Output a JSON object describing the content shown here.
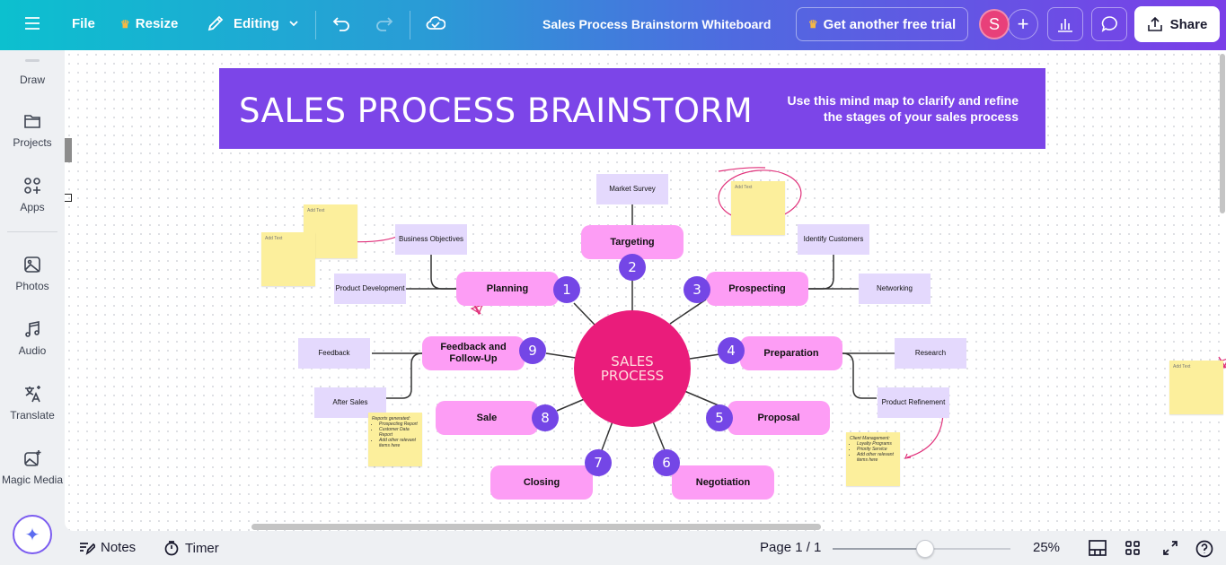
{
  "topbar": {
    "file_label": "File",
    "resize_label": "Resize",
    "editing_label": "Editing",
    "doc_title": "Sales Process Brainstorm Whiteboard",
    "trial_label": "Get another free trial",
    "avatar_initial": "S",
    "add_label": "+",
    "share_label": "Share"
  },
  "sidebar": {
    "items": [
      {
        "label": "Draw",
        "icon": "draw-icon"
      },
      {
        "label": "Projects",
        "icon": "folder-icon"
      },
      {
        "label": "Apps",
        "icon": "apps-icon"
      },
      {
        "label": "Photos",
        "icon": "photo-icon"
      },
      {
        "label": "Audio",
        "icon": "music-icon"
      },
      {
        "label": "Translate",
        "icon": "translate-icon"
      },
      {
        "label": "Magic Media",
        "icon": "magic-media-icon"
      }
    ],
    "magic_button": "✦"
  },
  "board": {
    "title": "SALES PROCESS BRAINSTORM",
    "subtitle_line1": "Use this mind map to clarify and refine",
    "subtitle_line2": "the stages of your sales process",
    "center_line1": "SALES",
    "center_line2": "PROCESS",
    "stages": [
      {
        "num": "1",
        "label": "Planning"
      },
      {
        "num": "2",
        "label": "Targeting"
      },
      {
        "num": "3",
        "label": "Prospecting"
      },
      {
        "num": "4",
        "label": "Preparation"
      },
      {
        "num": "5",
        "label": "Proposal"
      },
      {
        "num": "6",
        "label": "Negotiation"
      },
      {
        "num": "7",
        "label": "Closing"
      },
      {
        "num": "8",
        "label": "Sale"
      },
      {
        "num": "9",
        "label": "Feedback and Follow-Up"
      }
    ],
    "subtopics": {
      "market_survey": "Market Survey",
      "business_objectives": "Business Objectives",
      "product_development": "Product Development",
      "identify_customers": "Identify Customers",
      "networking": "Networking",
      "research": "Research",
      "product_refinement": "Product Refinement",
      "feedback": "Feedback",
      "after_sales": "After Sales"
    },
    "stickies": {
      "placeholder": "Add Text",
      "reports_heading": "Reports generated:",
      "reports_items": [
        "Prospecting Report",
        "Customer Data Report",
        "Add other relevant items here"
      ],
      "client_heading": "Client Management:",
      "client_items": [
        "Loyalty Programs",
        "Priority Service",
        "Add other relevant items here"
      ]
    }
  },
  "bottombar": {
    "notes_label": "Notes",
    "timer_label": "Timer",
    "page_label": "Page 1 / 1",
    "zoom_label": "25%",
    "zoom_slider_fraction": 0.52
  },
  "colors": {
    "banner": "#7c45e8",
    "stage": "#fd9df5",
    "number": "#7446e6",
    "center": "#ea1c7b",
    "subtopic": "#e4d9fd",
    "sticky": "#fcef9c",
    "annotation": "#e0317b"
  }
}
